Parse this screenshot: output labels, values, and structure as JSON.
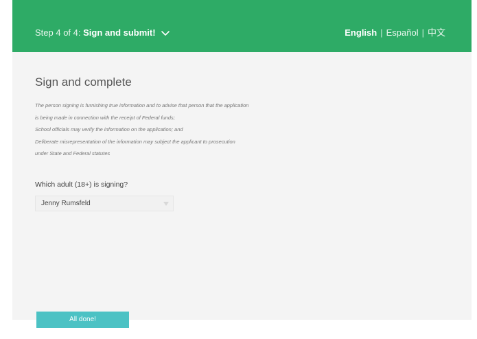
{
  "header": {
    "step_prefix": "Step 4 of 4:",
    "step_title": "Sign and submit!",
    "languages": [
      {
        "label": "English",
        "active": true
      },
      {
        "label": "Español",
        "active": false
      },
      {
        "label": "中文",
        "active": false
      }
    ],
    "separator": "|",
    "toggle_icon": "chevron-down-icon"
  },
  "main": {
    "heading": "Sign and complete",
    "legal_lines": [
      "The person signing is furnishing true information and to advise that person that the application",
      "is being made in connection with the receipt of Federal funds;",
      "School officials may verify the information on the application; and",
      "Deliberate misrepresentation of the information may subject the applicant to prosecution",
      "under State and Federal statutes"
    ],
    "question": "Which adult (18+) is signing?",
    "signer_select": {
      "selected": "Jenny Rumsfeld"
    },
    "done_button": "All done!"
  },
  "colors": {
    "header_bg": "#2eab66",
    "page_bg": "#f4f4f4",
    "button_bg": "#4cc2c4"
  }
}
